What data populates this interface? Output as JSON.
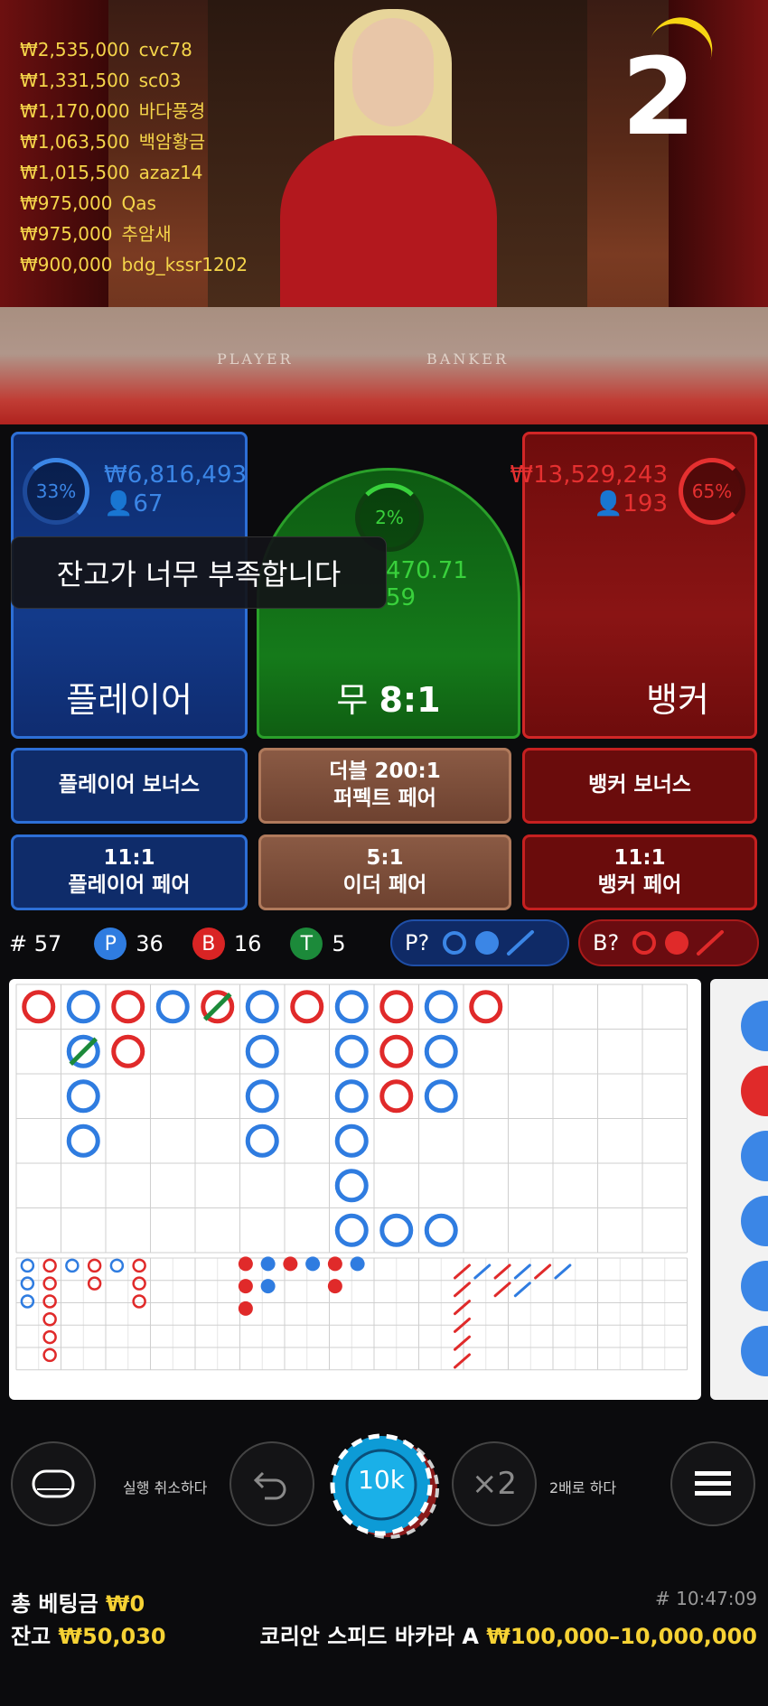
{
  "video": {
    "countdown": "2",
    "table_left_label": "PLAYER",
    "table_right_label": "BANKER"
  },
  "winners": [
    {
      "amount": "₩2,535,000",
      "name": "cvc78"
    },
    {
      "amount": "₩1,331,500",
      "name": "sc03"
    },
    {
      "amount": "₩1,170,000",
      "name": "바다풍경"
    },
    {
      "amount": "₩1,063,500",
      "name": "백암황금"
    },
    {
      "amount": "₩1,015,500",
      "name": "azaz14"
    },
    {
      "amount": "₩975,000",
      "name": "Qas"
    },
    {
      "amount": "₩975,000",
      "name": "추암새"
    },
    {
      "amount": "₩900,000",
      "name": "bdg_kssr1202"
    }
  ],
  "player": {
    "percent": "33%",
    "amount": "₩6,816,493",
    "users": "67",
    "label": "플레이어",
    "percent_value": 0.33
  },
  "banker": {
    "percent": "65%",
    "amount": "₩13,529,243",
    "users": "193",
    "label": "뱅커",
    "percent_value": 0.65
  },
  "tie": {
    "percent": "2%",
    "amount": "470.71",
    "users": "59",
    "label_word": "무",
    "label_odds": "8:1"
  },
  "toast": "잔고가 너무 부족합니다",
  "side_bets": {
    "player_bonus": "플레이어 보너스",
    "double_perfect_odds": "더블 200:1",
    "double_perfect_label": "퍼펙트 페어",
    "banker_bonus": "뱅커 보너스",
    "player_pair_odds": "11:1",
    "player_pair_label": "플레이어 페어",
    "either_pair_odds": "5:1",
    "either_pair_label": "이더 페어",
    "banker_pair_odds": "11:1",
    "banker_pair_label": "뱅커 페어"
  },
  "stats": {
    "rounds_label": "# 57",
    "p_letter": "P",
    "p_count": "36",
    "b_letter": "B",
    "b_count": "16",
    "t_letter": "T",
    "t_count": "5"
  },
  "predict": {
    "player": "P?",
    "banker": "B?"
  },
  "controls": {
    "undo_label": "실행 취소하다",
    "chip_value": "10k",
    "double_symbol": "×2",
    "double_label": "2배로 하다"
  },
  "footer": {
    "total_bet_label": "총 베팅금",
    "total_bet_value": "₩0",
    "balance_label": "잔고",
    "balance_value": "₩50,030",
    "round_id": "# 10:47:09",
    "table_name": "코리안 스피드 바카라 A",
    "limits": "₩100,000–10,000,000"
  },
  "colors": {
    "player_blue": "#3b86e6",
    "banker_red": "#e02a2a",
    "tie_green": "#2aa02a",
    "gold": "#f6d234"
  }
}
